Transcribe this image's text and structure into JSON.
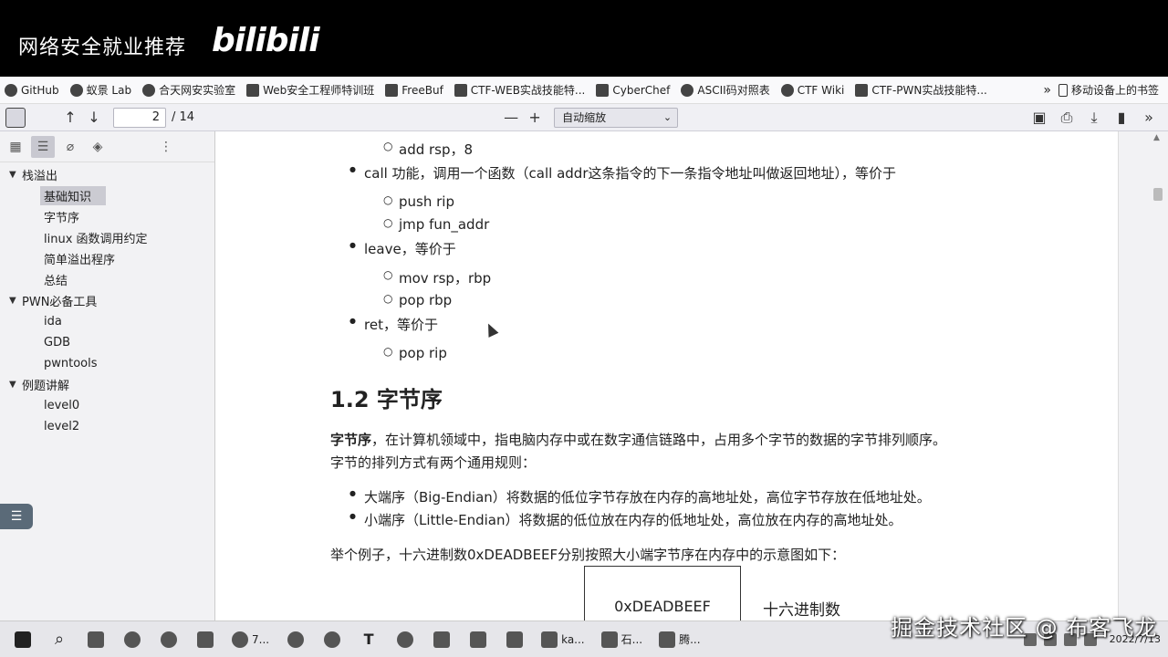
{
  "banner": {
    "title": "网络安全就业推荐",
    "logo": "bilibili"
  },
  "bookmarks": {
    "items": [
      {
        "label": "GitHub",
        "icon": "github-icon"
      },
      {
        "label": "蚁景 Lab",
        "icon": "ant-icon"
      },
      {
        "label": "合天网安实验室",
        "icon": "shield-icon"
      },
      {
        "label": "Web安全工程师特训班",
        "icon": "diamond-icon"
      },
      {
        "label": "FreeBuf",
        "icon": "freebuf-icon"
      },
      {
        "label": "CTF-WEB实战技能特...",
        "icon": "diamond-icon"
      },
      {
        "label": "CyberChef",
        "icon": "page-icon"
      },
      {
        "label": "ASCII码对照表",
        "icon": "c-icon"
      },
      {
        "label": "CTF Wiki",
        "icon": "ctfwiki-icon"
      },
      {
        "label": "CTF-PWN实战技能特...",
        "icon": "diamond-icon"
      }
    ],
    "more": "»",
    "mobile": "移动设备上的书签"
  },
  "toolbar": {
    "page_current": "2",
    "page_total": "/ 14",
    "zoom": "自动缩放",
    "minus": "—",
    "plus": "+"
  },
  "outline": [
    {
      "label": "栈溢出",
      "level": 1
    },
    {
      "label": "基础知识",
      "level": 2,
      "selected": true
    },
    {
      "label": "字节序",
      "level": 2
    },
    {
      "label": "linux 函数调用约定",
      "level": 2
    },
    {
      "label": "简单溢出程序",
      "level": 2
    },
    {
      "label": "总结",
      "level": 2
    },
    {
      "label": "PWN必备工具",
      "level": 1
    },
    {
      "label": "ida",
      "level": 2
    },
    {
      "label": "GDB",
      "level": 2
    },
    {
      "label": "pwntools",
      "level": 2
    },
    {
      "label": "例题讲解",
      "level": 1
    },
    {
      "label": "level0",
      "level": 2
    },
    {
      "label": "level2",
      "level": 2
    }
  ],
  "doc": {
    "add_rsp": "add  rsp，8",
    "call_line": "call   功能，调用一个函数（call addr这条指令的下一条指令地址叫做返回地址），等价于",
    "push_rip": "push rip",
    "jmp_fun": "jmp  fun_addr",
    "leave_line": "leave，等价于",
    "mov_rsp": "mov rsp，rbp",
    "pop_rbp": "pop  rbp",
    "ret_line": "ret，等价于",
    "pop_rip": "pop rip",
    "heading": "1.2 字节序",
    "para_bold": "字节序",
    "para_rest": "，在计算机领域中，指电脑内存中或在数字通信链路中，占用多个字节的数据的字节排列顺序。",
    "para2": "字节的排列方式有两个通用规则：",
    "big_endian": "大端序（Big-Endian）将数据的低位字节存放在内存的高地址处，高位字节存放在低地址处。",
    "little_endian": "小端序（Little-Endian）将数据的低位放在内存的低地址处，高位放在内存的高地址处。",
    "example": "举个例子，十六进制数0xDEADBEEF分别按照大小端字节序在内存中的示意图如下：",
    "box_value": "0xDEADBEEF",
    "box_label": "十六进制数"
  },
  "taskbar": {
    "firefox_label": "7...",
    "kali_label": "ka...",
    "stone_label": "石...",
    "tencent_label": "腾..."
  },
  "clock": {
    "time": "",
    "date": "2022/7/13"
  },
  "watermark": "掘金技术社区 @ 布客飞龙"
}
